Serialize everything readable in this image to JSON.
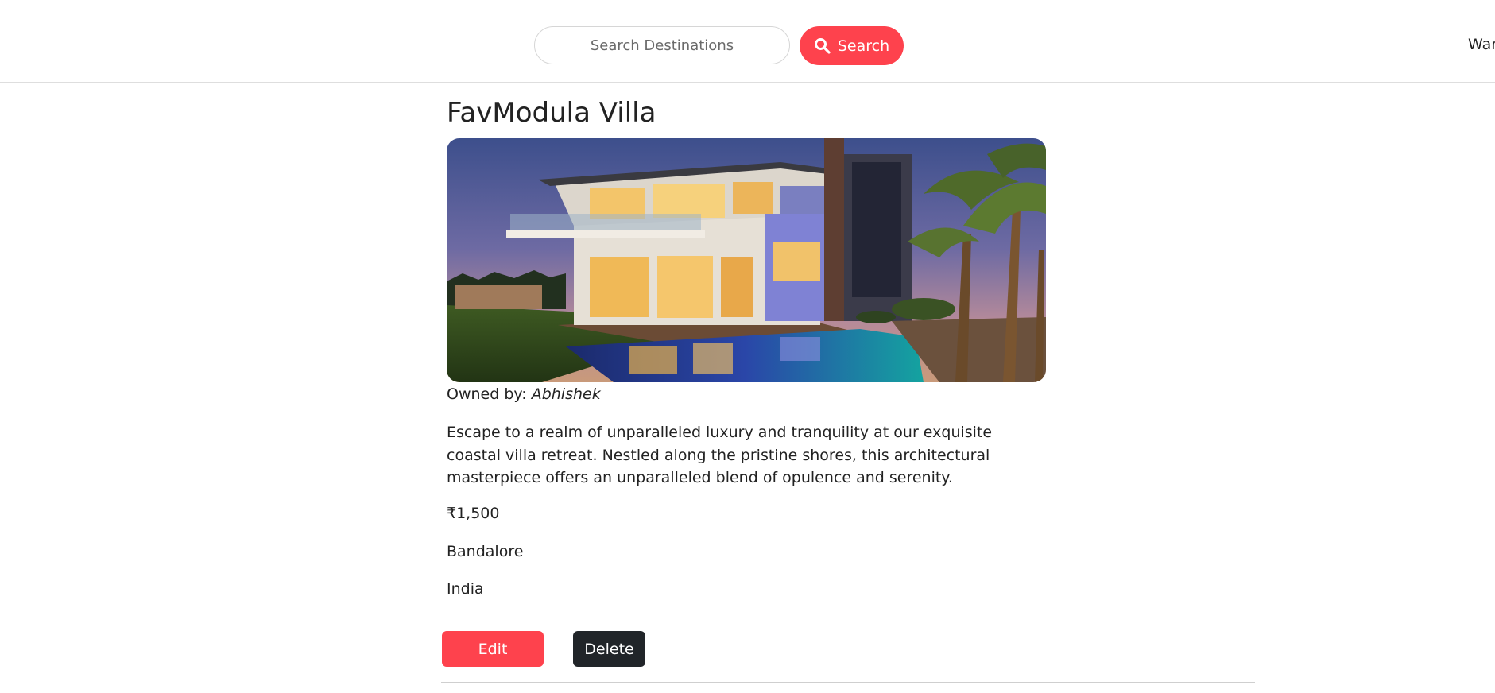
{
  "navbar": {
    "search_placeholder": "Search Destinations",
    "search_button_label": "Search",
    "right_link_label": "War"
  },
  "listing": {
    "title": "FavModula Villa",
    "owner_prefix": "Owned by: ",
    "owner_name": "Abhishek",
    "description": "Escape to a realm of unparalleled luxury and tranquility at our exquisite coastal villa retreat. Nestled along the pristine shores, this architectural masterpiece offers an unparalleled blend of opulence and serenity.",
    "price": "₹1,500",
    "location": "Bandalore",
    "country": "India"
  },
  "actions": {
    "edit_label": "Edit",
    "delete_label": "Delete"
  },
  "icons": {
    "search": "search-icon"
  },
  "colors": {
    "accent": "#fe424d",
    "dark_button": "#212529",
    "text": "#222222"
  }
}
